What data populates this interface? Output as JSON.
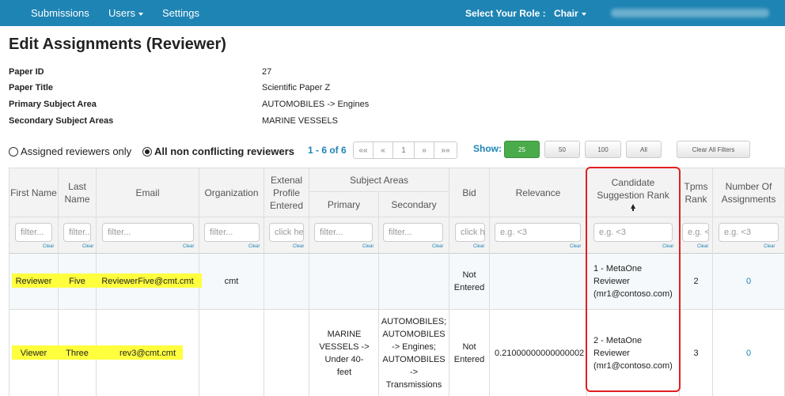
{
  "nav": {
    "submissions": "Submissions",
    "users": "Users",
    "settings": "Settings",
    "role_label": "Select Your Role :",
    "role_value": "Chair"
  },
  "page_title": "Edit Assignments (Reviewer)",
  "paper": {
    "id_label": "Paper ID",
    "id_value": "27",
    "title_label": "Paper Title",
    "title_value": "Scientific Paper Z",
    "primary_label": "Primary Subject Area",
    "primary_value": "AUTOMOBILES -> Engines",
    "secondary_label": "Secondary Subject Areas",
    "secondary_value": "MARINE VESSELS"
  },
  "filters": {
    "assigned_only": "Assigned reviewers only",
    "all_non_conflicting": "All non conflicting reviewers",
    "selected": "all_non_conflicting"
  },
  "pager": {
    "range": "1 - 6 of 6",
    "first": "««",
    "prev": "«",
    "page": "1",
    "next": "»",
    "last": "»»"
  },
  "show": {
    "label": "Show:",
    "sizes": [
      "25",
      "50",
      "100",
      "All"
    ],
    "active": "25",
    "clear_all": "Clear All Filters"
  },
  "columns": {
    "first_name": "First Name",
    "last_name": "Last Name",
    "email": "Email",
    "organization": "Organization",
    "extenal_profile": "Extenal Profile Entered",
    "subject_areas": "Subject Areas",
    "primary": "Primary",
    "secondary": "Secondary",
    "bid": "Bid",
    "relevance": "Relevance",
    "candidate_rank": "Candidate Suggestion Rank",
    "tpms_rank": "Tpms Rank",
    "num_assignments": "Number Of Assignments"
  },
  "placeholders": {
    "first_name": "filter...",
    "last_name": "filter...",
    "email": "filter...",
    "organization": "filter...",
    "extenal_profile": "click here",
    "primary": "filter...",
    "secondary": "filter...",
    "bid": "click here",
    "relevance": "e.g. <3",
    "candidate_rank": "e.g. <3",
    "tpms_rank": "e.g. <3",
    "num_assignments": "e.g. <3"
  },
  "clear_label": "Clear",
  "rows": [
    {
      "first_name": "Reviewer",
      "last_name": "Five",
      "email": "ReviewerFive@cmt.cmt",
      "organization": "cmt",
      "extenal_profile": "",
      "primary": "",
      "secondary": "",
      "bid": "Not Entered",
      "relevance": "",
      "candidate_rank": "1 - MetaOne Reviewer (mr1@contoso.com)",
      "tpms_rank": "2",
      "num_assignments": "0"
    },
    {
      "first_name": "Viewer",
      "last_name": "Three",
      "email": "rev3@cmt.cmt",
      "organization": "",
      "extenal_profile": "",
      "primary": "MARINE VESSELS -> Under 40-feet",
      "secondary": "AUTOMOBILES; AUTOMOBILES -> Engines; AUTOMOBILES -> Transmissions",
      "bid": "Not Entered",
      "relevance": "0.21000000000000002",
      "candidate_rank": "2 - MetaOne Reviewer (mr1@contoso.com)",
      "tpms_rank": "3",
      "num_assignments": "0"
    }
  ],
  "colors": {
    "navbar": "#1e84b4",
    "highlight": "#ffff3e",
    "annotation_box": "#e02020",
    "active_size": "#4aab4a"
  }
}
